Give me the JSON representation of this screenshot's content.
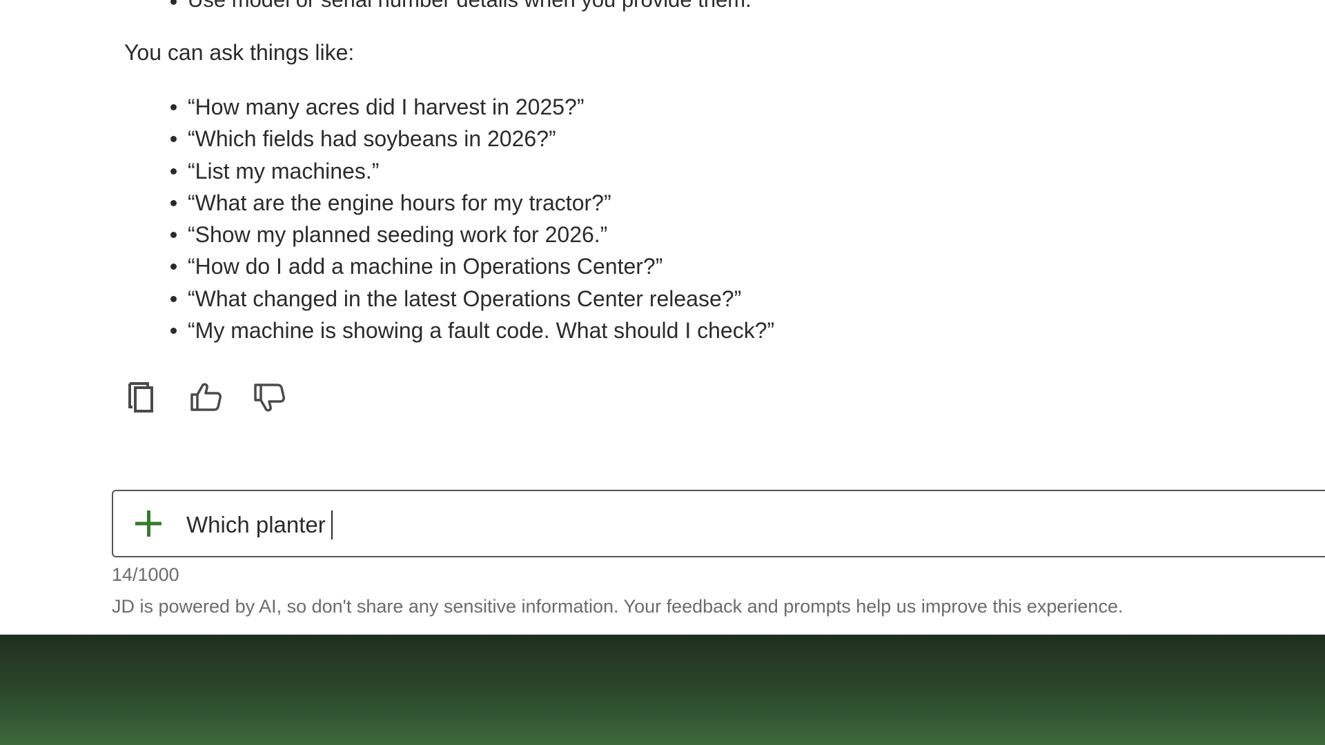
{
  "response": {
    "prev_bullet": "Use model or serial number details when you provide them.",
    "intro": "You can ask things like:",
    "examples": [
      "“How many acres did I harvest in 2025?”",
      "“Which fields had soybeans in 2026?”",
      "“List my machines.”",
      "“What are the engine hours for my tractor?”",
      "“Show my planned seeding work for 2026.”",
      "“How do I add a machine in Operations Center?”",
      "“What changed in the latest Operations Center release?”",
      "“My machine is showing a fault code. What should I check?”"
    ],
    "actions": {
      "copy_icon": "copy-icon",
      "like_icon": "thumbs-up-icon",
      "dislike_icon": "thumbs-down-icon"
    }
  },
  "composer": {
    "add_icon": "plus-icon",
    "value": "Which planter",
    "char_count": "14/1000",
    "disclaimer": "JD is powered by AI, so don't share any sensitive information. Your feedback and prompts help us improve this experience."
  },
  "colors": {
    "accent": "#367c2b",
    "text": "#2b2b2b",
    "muted": "#6b6b6b",
    "backdrop_dark": "#1f2e1f",
    "backdrop_light": "#3c6a3c"
  }
}
